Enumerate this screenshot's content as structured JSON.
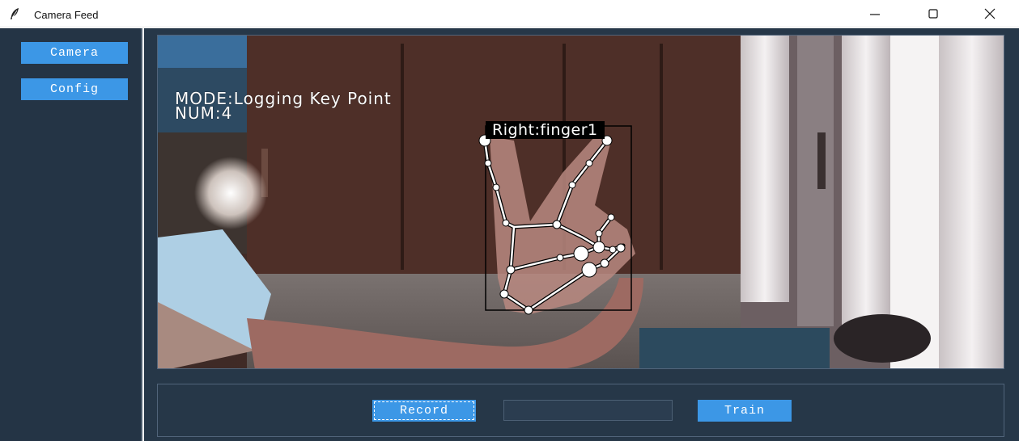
{
  "window": {
    "title": "Camera Feed",
    "controls": [
      "minimize-icon",
      "maximize-icon",
      "close-icon"
    ]
  },
  "sidebar": {
    "items": [
      {
        "label": "Camera"
      },
      {
        "label": "Config"
      }
    ]
  },
  "video": {
    "mode_text": "MODE:Logging Key Point",
    "num_text": "NUM:4",
    "hand_label": "Right:finger1"
  },
  "controls": {
    "record_label": "Record",
    "train_label": "Train",
    "label_input_value": "",
    "label_input_placeholder": ""
  },
  "colors": {
    "sidebar_bg": "#243445",
    "main_bg": "#263748",
    "button_blue": "#3c97e6",
    "border": "#51647a"
  }
}
